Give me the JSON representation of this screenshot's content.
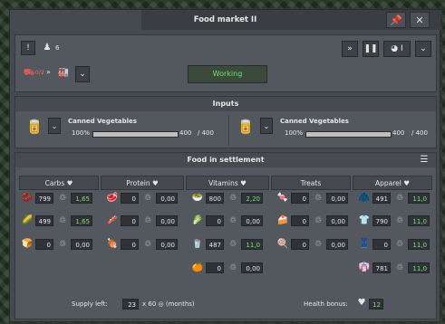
{
  "window": {
    "title": "Food market II",
    "pin_icon": "pin-icon",
    "close_icon": "close-icon"
  },
  "toolbar": {
    "workers_count": "6",
    "status": "Working",
    "icons": [
      "info-icon",
      "workers-icon",
      "collapse-icon",
      "pause-icon",
      "priority-icon",
      "chevron-down-icon"
    ],
    "priority_label": "I"
  },
  "route": {
    "truck_badge": "0/2",
    "arrow": "»"
  },
  "inputs": {
    "title": "Inputs",
    "items": [
      {
        "name": "Canned Vegetables",
        "percent": "100%",
        "current": "400",
        "max": "/ 400"
      },
      {
        "name": "Canned Vegetables",
        "percent": "100%",
        "current": "400",
        "max": "/ 400"
      }
    ]
  },
  "food": {
    "title": "Food in settlement",
    "columns": [
      "Carbs",
      "Protein",
      "Vitamins",
      "Treats",
      "Apparel"
    ],
    "rows": [
      [
        {
          "v": "799",
          "r": "1,65",
          "g": true
        },
        {
          "v": "0",
          "r": "0,00"
        },
        {
          "v": "800",
          "r": "2,20",
          "g": true
        },
        {
          "v": "0",
          "r": "0,00"
        },
        {
          "v": "491",
          "r": "11,0",
          "g": true
        }
      ],
      [
        {
          "v": "499",
          "r": "1,65",
          "g": true
        },
        {
          "v": "0",
          "r": "0,00"
        },
        {
          "v": "0",
          "r": "0,00"
        },
        {
          "v": "0",
          "r": "0,00"
        },
        {
          "v": "790",
          "r": "11,0",
          "g": true
        }
      ],
      [
        {
          "v": "0",
          "r": "0,00"
        },
        {
          "v": "0",
          "r": "0,00"
        },
        {
          "v": "487",
          "r": "11,0",
          "g": true
        },
        {
          "v": "0",
          "r": "0,00"
        },
        {
          "v": "0",
          "r": "11,0",
          "g": true
        }
      ],
      [
        null,
        null,
        {
          "v": "0",
          "r": "0,00"
        },
        null,
        {
          "v": "781",
          "r": "11,0",
          "g": true
        }
      ]
    ],
    "supply_label": "Supply left:",
    "supply_value": "23",
    "supply_suffix": "x 60 ◎ (months)",
    "health_label": "Health bonus:",
    "health_value": "12"
  },
  "colors": {
    "green": "#6fe26f",
    "panel": "#53585e",
    "status_bg": "#3c4a3c"
  }
}
